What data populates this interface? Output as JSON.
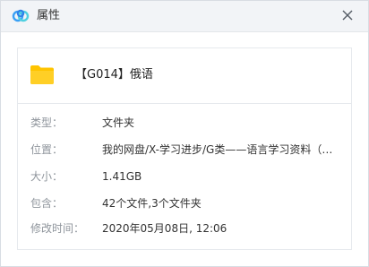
{
  "window": {
    "title": "属性",
    "icon": "baidu-netdisk-icon",
    "close_icon": "close-icon"
  },
  "file": {
    "icon": "folder-icon",
    "folder_color": "#ffc400",
    "name": "【G014】俄语"
  },
  "properties": [
    {
      "label": "类型：",
      "value": "文件夹"
    },
    {
      "label": "位置：",
      "value": "我的网盘/X-学习进步/G类——语言学习资料（…"
    },
    {
      "label": "大小：",
      "value": "1.41GB"
    },
    {
      "label": "包含：",
      "value": "42个文件,3个文件夹"
    },
    {
      "label": "修改时间：",
      "value": "2020年05月08日, 12:06"
    }
  ]
}
